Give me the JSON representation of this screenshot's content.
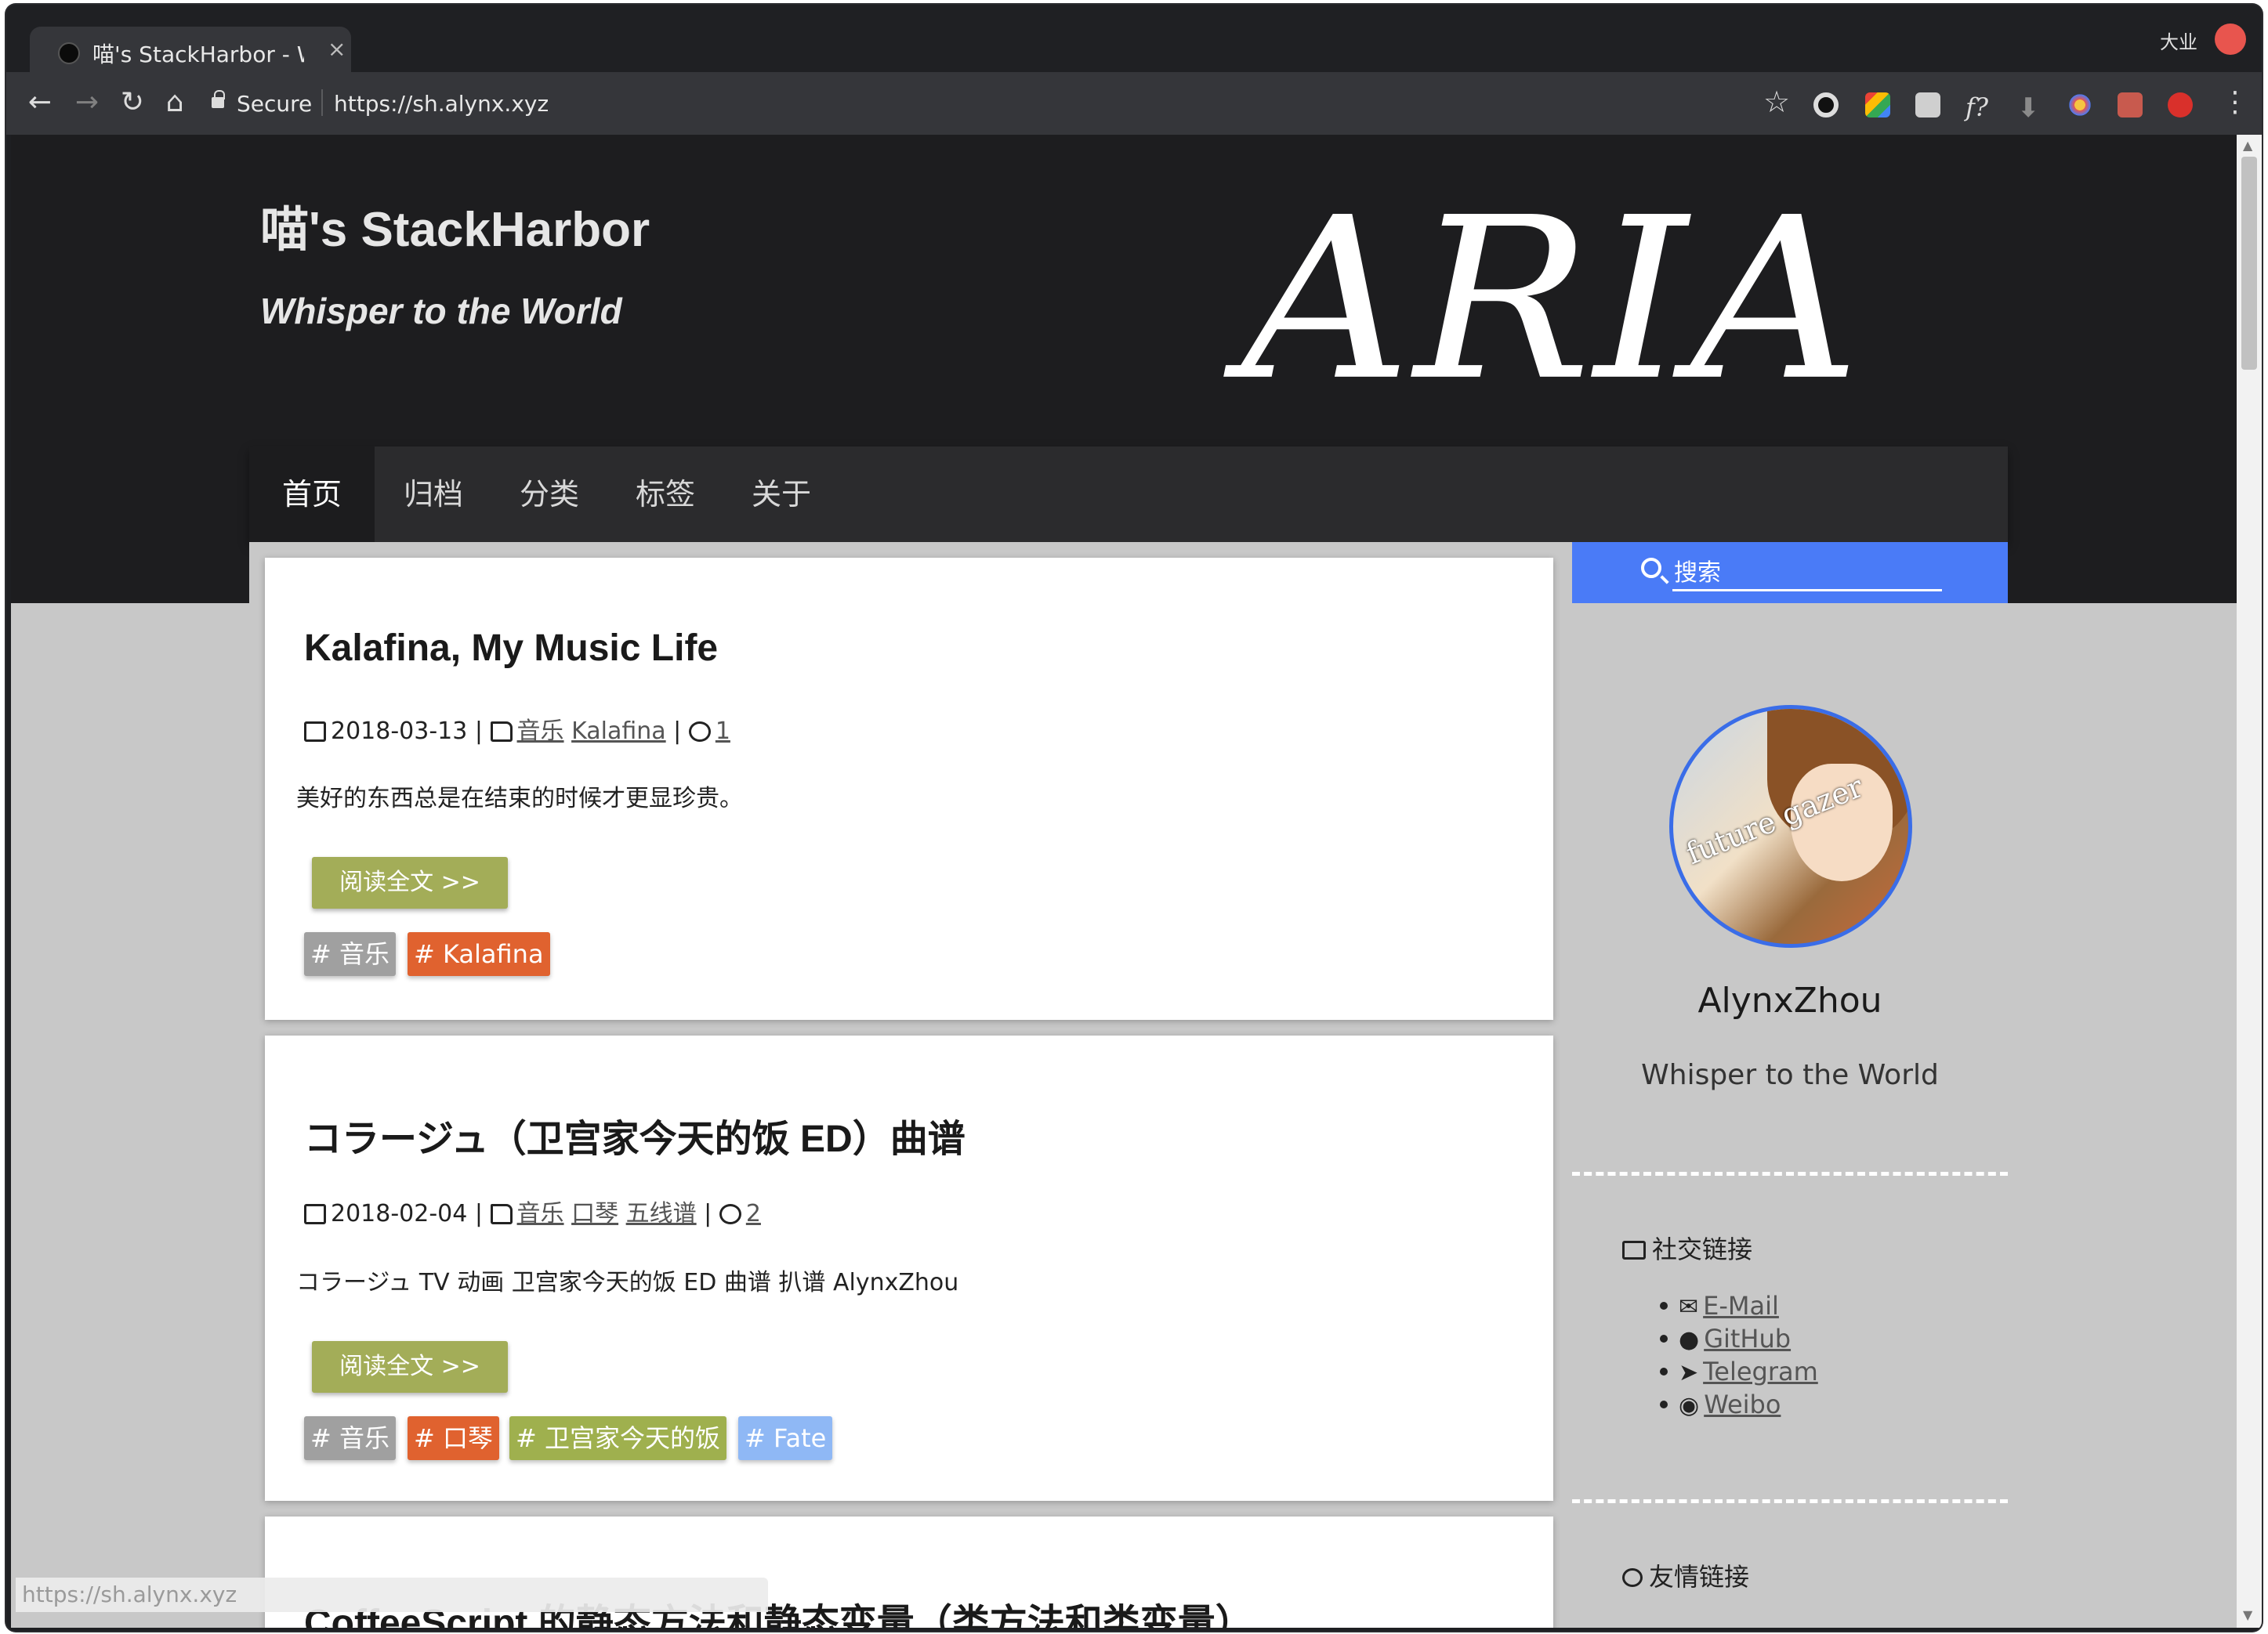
{
  "browser": {
    "tab_title": "喵's StackHarbor - W",
    "tab_close": "×",
    "ime_label": "大业",
    "secure_label": "Secure",
    "url": "https://sh.alynx.xyz",
    "status_url": "https://sh.alynx.xyz"
  },
  "site": {
    "title": "喵's StackHarbor",
    "subtitle": "Whisper to the World",
    "hero_art": "ARIA"
  },
  "nav": [
    "首页",
    "归档",
    "分类",
    "标签",
    "关于"
  ],
  "posts": [
    {
      "title": "Kalafina, My Music Life",
      "date": "2018-03-13",
      "categories": [
        "音乐",
        "Kalafina"
      ],
      "comments": "1",
      "excerpt": "美好的东西总是在结束的时候才更显珍贵。",
      "read_more": "阅读全文 >>",
      "tags": [
        {
          "label": "# 音乐",
          "color": "#a0a0a0"
        },
        {
          "label": "# Kalafina",
          "color": "#e0622f"
        }
      ]
    },
    {
      "title": "コラージュ（卫宫家今天的饭 ED）曲谱",
      "date": "2018-02-04",
      "categories": [
        "音乐",
        "口琴",
        "五线谱"
      ],
      "comments": "2",
      "excerpt": "コラージュ TV 动画 卫宫家今天的饭 ED 曲谱 扒谱 AlynxZhou",
      "read_more": "阅读全文 >>",
      "tags": [
        {
          "label": "# 音乐",
          "color": "#a0a0a0"
        },
        {
          "label": "# 口琴",
          "color": "#e0622f"
        },
        {
          "label": "# 卫宫家今天的饭",
          "color": "#9fb04e"
        },
        {
          "label": "# Fate",
          "color": "#8fb8f5"
        }
      ]
    },
    {
      "title": "CoffeeScript 的静态方法和静态变量（类方法和类变量）"
    }
  ],
  "sidebar": {
    "search_placeholder": "搜索",
    "author": "AlynxZhou",
    "author_sub": "Whisper to the World",
    "avatar_text": "future gazer",
    "social_title": "社交链接",
    "social_links": [
      {
        "label": "E-Mail",
        "icon": "mail-icon"
      },
      {
        "label": "GitHub",
        "icon": "github-icon"
      },
      {
        "label": "Telegram",
        "icon": "telegram-icon"
      },
      {
        "label": "Weibo",
        "icon": "weibo-icon"
      }
    ],
    "friends_title": "友情链接"
  },
  "colors": {
    "accent_blue": "#4a7bf7",
    "read_button": "#a3ad58",
    "hero_bg": "#1d1d1f"
  }
}
